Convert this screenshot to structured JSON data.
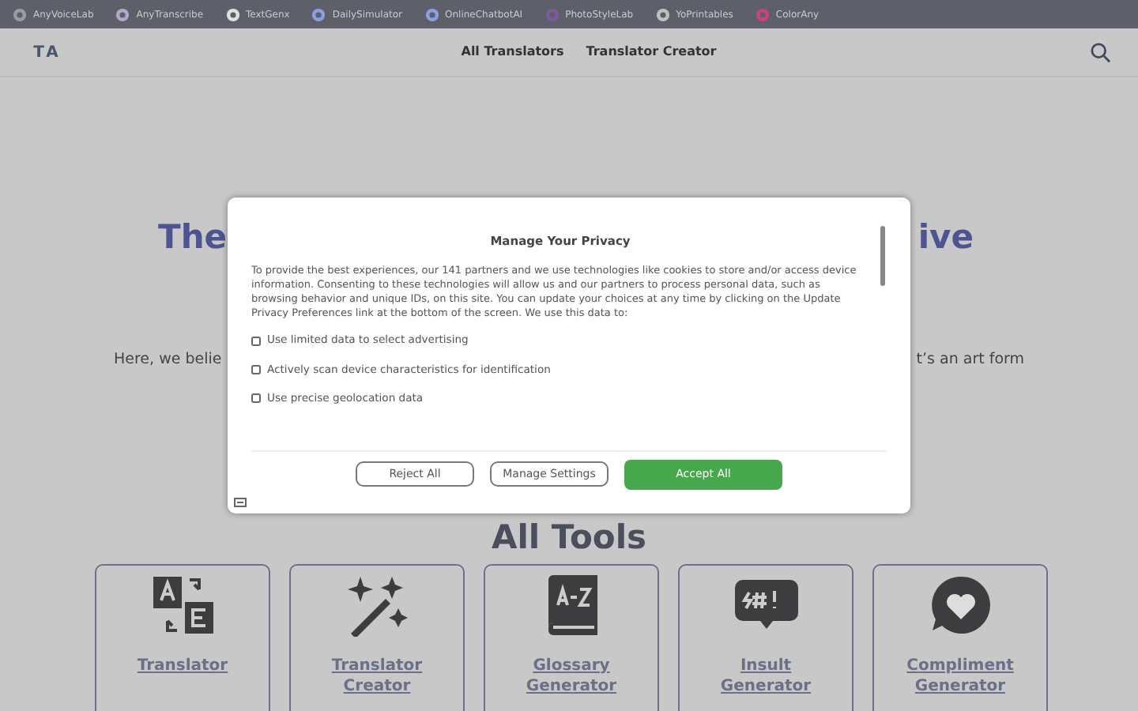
{
  "topbar": {
    "links": [
      {
        "label": "AnyVoiceLab"
      },
      {
        "label": "AnyTranscribe"
      },
      {
        "label": "TextGenx"
      },
      {
        "label": "DailySimulator"
      },
      {
        "label": "OnlineChatbotAI"
      },
      {
        "label": "PhotoStyleLab"
      },
      {
        "label": "YoPrintables"
      },
      {
        "label": "ColorAny"
      }
    ]
  },
  "nav": {
    "logo": "TA",
    "links": [
      {
        "label": "All Translators"
      },
      {
        "label": "Translator Creator"
      }
    ]
  },
  "hero": {
    "headline_fragments": [
      "The",
      "ive"
    ],
    "intro_fragments": [
      "Here, we belie",
      "t’s an art form"
    ]
  },
  "consent": {
    "title": "Manage Your Privacy",
    "body": "To provide the best experiences, our 141 partners and we use technologies like cookies to store and/or access device information. Consenting to these technologies will allow us and our partners to process personal data, such as browsing behavior and unique IDs, on this site. You can update your choices at any time by clicking on the Update Privacy Preferences link at the bottom of the screen. We use this data to:",
    "purposes": [
      {
        "label": "Use limited data to select advertising"
      },
      {
        "label": "Actively scan device characteristics for identification"
      },
      {
        "label": "Use precise geolocation data"
      }
    ],
    "buttons": [
      {
        "label": "Reject All",
        "kind": "outline"
      },
      {
        "label": "Manage Settings",
        "kind": "outline"
      },
      {
        "label": "Accept All",
        "kind": "primary"
      }
    ]
  },
  "tools": {
    "title": "All Tools",
    "items": [
      {
        "label": "Translator"
      },
      {
        "label": "Translator Creator"
      },
      {
        "label": "Glossary Generator"
      },
      {
        "label": "Insult Generator"
      },
      {
        "label": "Compliment Generator"
      }
    ]
  }
}
